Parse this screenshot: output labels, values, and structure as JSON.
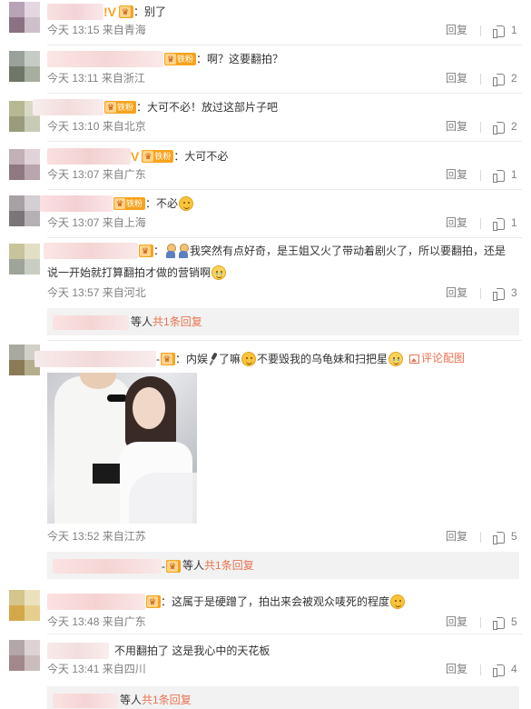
{
  "comments": [
    {
      "text": "：别了",
      "time": "今天 13:15",
      "location": "来自青海",
      "reply": "回复",
      "likes": "1"
    },
    {
      "badge": "铁粉",
      "text": "：啊？这要翻拍？",
      "time": "今天 13:11",
      "location": "来自浙江",
      "reply": "回复",
      "likes": "2"
    },
    {
      "badge": "铁粉",
      "text": "：大可不必！放过这部片子吧",
      "time": "今天 13:10",
      "location": "来自北京",
      "reply": "回复",
      "likes": "2"
    },
    {
      "badge": "铁粉",
      "text": "：大可不必",
      "time": "今天 13:07",
      "location": "来自广东",
      "reply": "回复",
      "likes": "1"
    },
    {
      "badge": "铁粉",
      "text": "：不必",
      "time": "今天 13:07",
      "location": "来自上海",
      "reply": "回复",
      "likes": "1"
    },
    {
      "text_line1": "我突然有点好奇，是王姐又火了带动着剧火了，所以要翻拍，还是",
      "text_line2": "说一开始就打算翻拍才做的营销啊",
      "time": "今天 13:57",
      "location": "来自河北",
      "reply": "回复",
      "likes": "3",
      "more_people": "等人",
      "more_replies": "共1条回复"
    },
    {
      "text_a": "：内娱",
      "text_b": "了嘛",
      "text_c": "不要毁我的乌龟妹和扫把星",
      "pic_link": "评论配图",
      "time": "今天 13:52",
      "location": "来自江苏",
      "reply": "回复",
      "likes": "5",
      "more_people": "等人",
      "more_replies": "共1条回复"
    },
    {
      "text": "：这属于是硬蹭了，拍出来会被观众唛死的程度",
      "time": "今天 13:48",
      "location": "来自广东",
      "reply": "回复",
      "likes": "5"
    },
    {
      "text": "不用翻拍了 这是我心中的天花板",
      "time": "今天 13:41",
      "location": "来自四川",
      "reply": "回复",
      "likes": "4",
      "more_people": "等人",
      "more_replies": "共1条回复"
    }
  ],
  "colors": {
    "accent": "#eb7350",
    "meta_text": "#808080",
    "badge": "#f7a31c",
    "reply_box": "#f2f2f2"
  }
}
